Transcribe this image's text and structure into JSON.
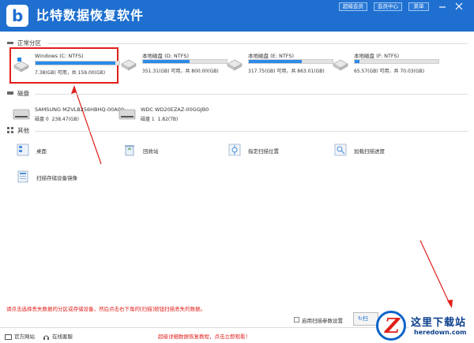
{
  "app": {
    "title": "比特数据恢复软件",
    "logo_letter": "b"
  },
  "topbar": {
    "vip_label": "超级会员",
    "member_label": "会员中心",
    "menu_label": "菜单"
  },
  "sections": {
    "partitions": "正常分区",
    "disks": "磁盘",
    "others": "其他"
  },
  "partitions": [
    {
      "name": "Windows (C: NTFS)",
      "info": "7.38(GB) 可用，共 159.00(GB)",
      "used_fraction": 0.95,
      "selected": true
    },
    {
      "name": "本地磁盘 (D: NTFS)",
      "info": "351.31(GB) 可用，共 800.00(GB)",
      "used_fraction": 0.56
    },
    {
      "name": "本地磁盘 (E: NTFS)",
      "info": "317.75(GB) 可用，共 863.01(GB)",
      "used_fraction": 0.63
    },
    {
      "name": "本地磁盘 (F: NTFS)",
      "info": "65.57(GB) 可用，共 70.03(GB)",
      "used_fraction": 0.06
    }
  ],
  "disks": [
    {
      "name": "SAMSUNG MZVLB256HBHQ-00A00",
      "index": "磁盘 0",
      "size": "238.47(GB)"
    },
    {
      "name": "WDC WD20EZAZ-00GGJB0",
      "index": "磁盘 1",
      "size": "1.82(TB)"
    }
  ],
  "others": [
    {
      "label": "桌面",
      "icon": "desktop-icon"
    },
    {
      "label": "回收站",
      "icon": "recycle-bin-icon"
    },
    {
      "label": "指定扫描位置",
      "icon": "scan-location-icon"
    },
    {
      "label": "加载扫描进度",
      "icon": "load-progress-icon"
    },
    {
      "label": "扫描存储设备镜像",
      "icon": "disk-image-icon"
    }
  ],
  "bottom": {
    "hint": "请点击选择丢失数据的分区或存储设备，然后点击右下角的[扫描]按钮扫描丢失的数据。",
    "scan_settings_label": "启用扫描参数设置",
    "scan_button_label": "扫"
  },
  "footer": {
    "website": "官方网站",
    "support": "在线客服",
    "tutorial": "超级详细数据恢复教程，点击立即观看！"
  },
  "watermark": {
    "glyph": "Z",
    "title": "这里下载站",
    "domain": "heredown.com"
  },
  "colors": {
    "accent": "#1e6fcf",
    "progress": "#2d8ae6",
    "highlight": "#e0201b"
  }
}
